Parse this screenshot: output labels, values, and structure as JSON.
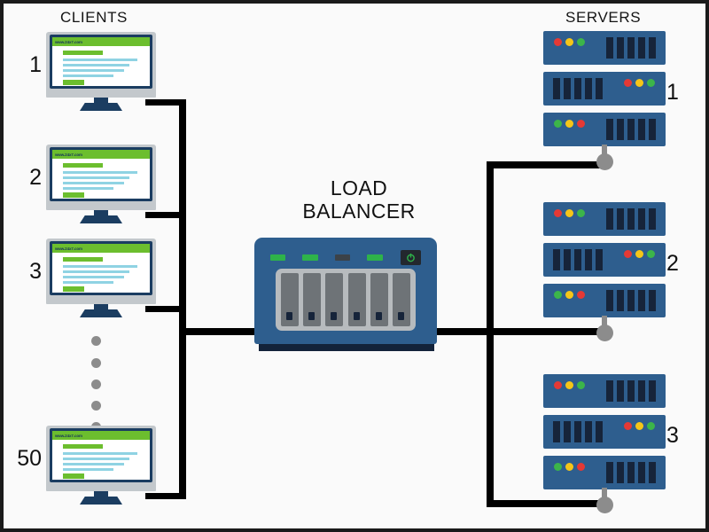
{
  "headings": {
    "clients": "CLIENTS",
    "servers": "SERVERS"
  },
  "load_balancer": {
    "title_line1": "LOAD",
    "title_line2": "BALANCER",
    "bay_count": 6,
    "leds": [
      {
        "name": "status-led-1",
        "state": "on",
        "color": "#2eb34a"
      },
      {
        "name": "status-led-2",
        "state": "on",
        "color": "#2eb34a"
      },
      {
        "name": "status-led-3",
        "state": "off",
        "color": "#3b4249"
      },
      {
        "name": "status-led-4",
        "state": "on",
        "color": "#2eb34a"
      }
    ],
    "power_button": {
      "icon": "power-icon",
      "icon_color": "#2eb34a",
      "body_color": "#23282e"
    },
    "body_color": "#2e5e8e",
    "bay_panel_color": "#b7bbbe"
  },
  "clients": [
    {
      "number": "1",
      "url": "www.24x7.com"
    },
    {
      "number": "2",
      "url": "www.24x7.com"
    },
    {
      "number": "3",
      "url": "www.24x7.com"
    },
    {
      "number": "50",
      "url": "www.24x7.com"
    }
  ],
  "client_ellipsis_dots": 5,
  "servers": [
    {
      "number": "1",
      "units": [
        {
          "leds_side": "left",
          "leds": [
            "#e53935",
            "#f5c518",
            "#3cb54a"
          ]
        },
        {
          "leds_side": "right",
          "leds": [
            "#e53935",
            "#f5c518",
            "#3cb54a"
          ]
        },
        {
          "leds_side": "left",
          "leds": [
            "#3cb54a",
            "#f5c518",
            "#e53935"
          ]
        }
      ]
    },
    {
      "number": "2",
      "units": [
        {
          "leds_side": "left",
          "leds": [
            "#e53935",
            "#f5c518",
            "#3cb54a"
          ]
        },
        {
          "leds_side": "right",
          "leds": [
            "#e53935",
            "#f5c518",
            "#3cb54a"
          ]
        },
        {
          "leds_side": "left",
          "leds": [
            "#3cb54a",
            "#f5c518",
            "#e53935"
          ]
        }
      ]
    },
    {
      "number": "3",
      "units": [
        {
          "leds_side": "left",
          "leds": [
            "#e53935",
            "#f5c518",
            "#3cb54a"
          ]
        },
        {
          "leds_side": "right",
          "leds": [
            "#e53935",
            "#f5c518",
            "#3cb54a"
          ]
        },
        {
          "leds_side": "left",
          "leds": [
            "#3cb54a",
            "#f5c518",
            "#e53935"
          ]
        }
      ]
    }
  ],
  "colors": {
    "frame": "#1a1a1a",
    "background": "#fafafa",
    "wire": "#000000",
    "device_blue": "#2e5e8e",
    "monitor_navy": "#1b3d61",
    "accent_green": "#6cbe2e",
    "text_blue": "#8fd3e3",
    "connector_gray": "#8c8c8c"
  }
}
